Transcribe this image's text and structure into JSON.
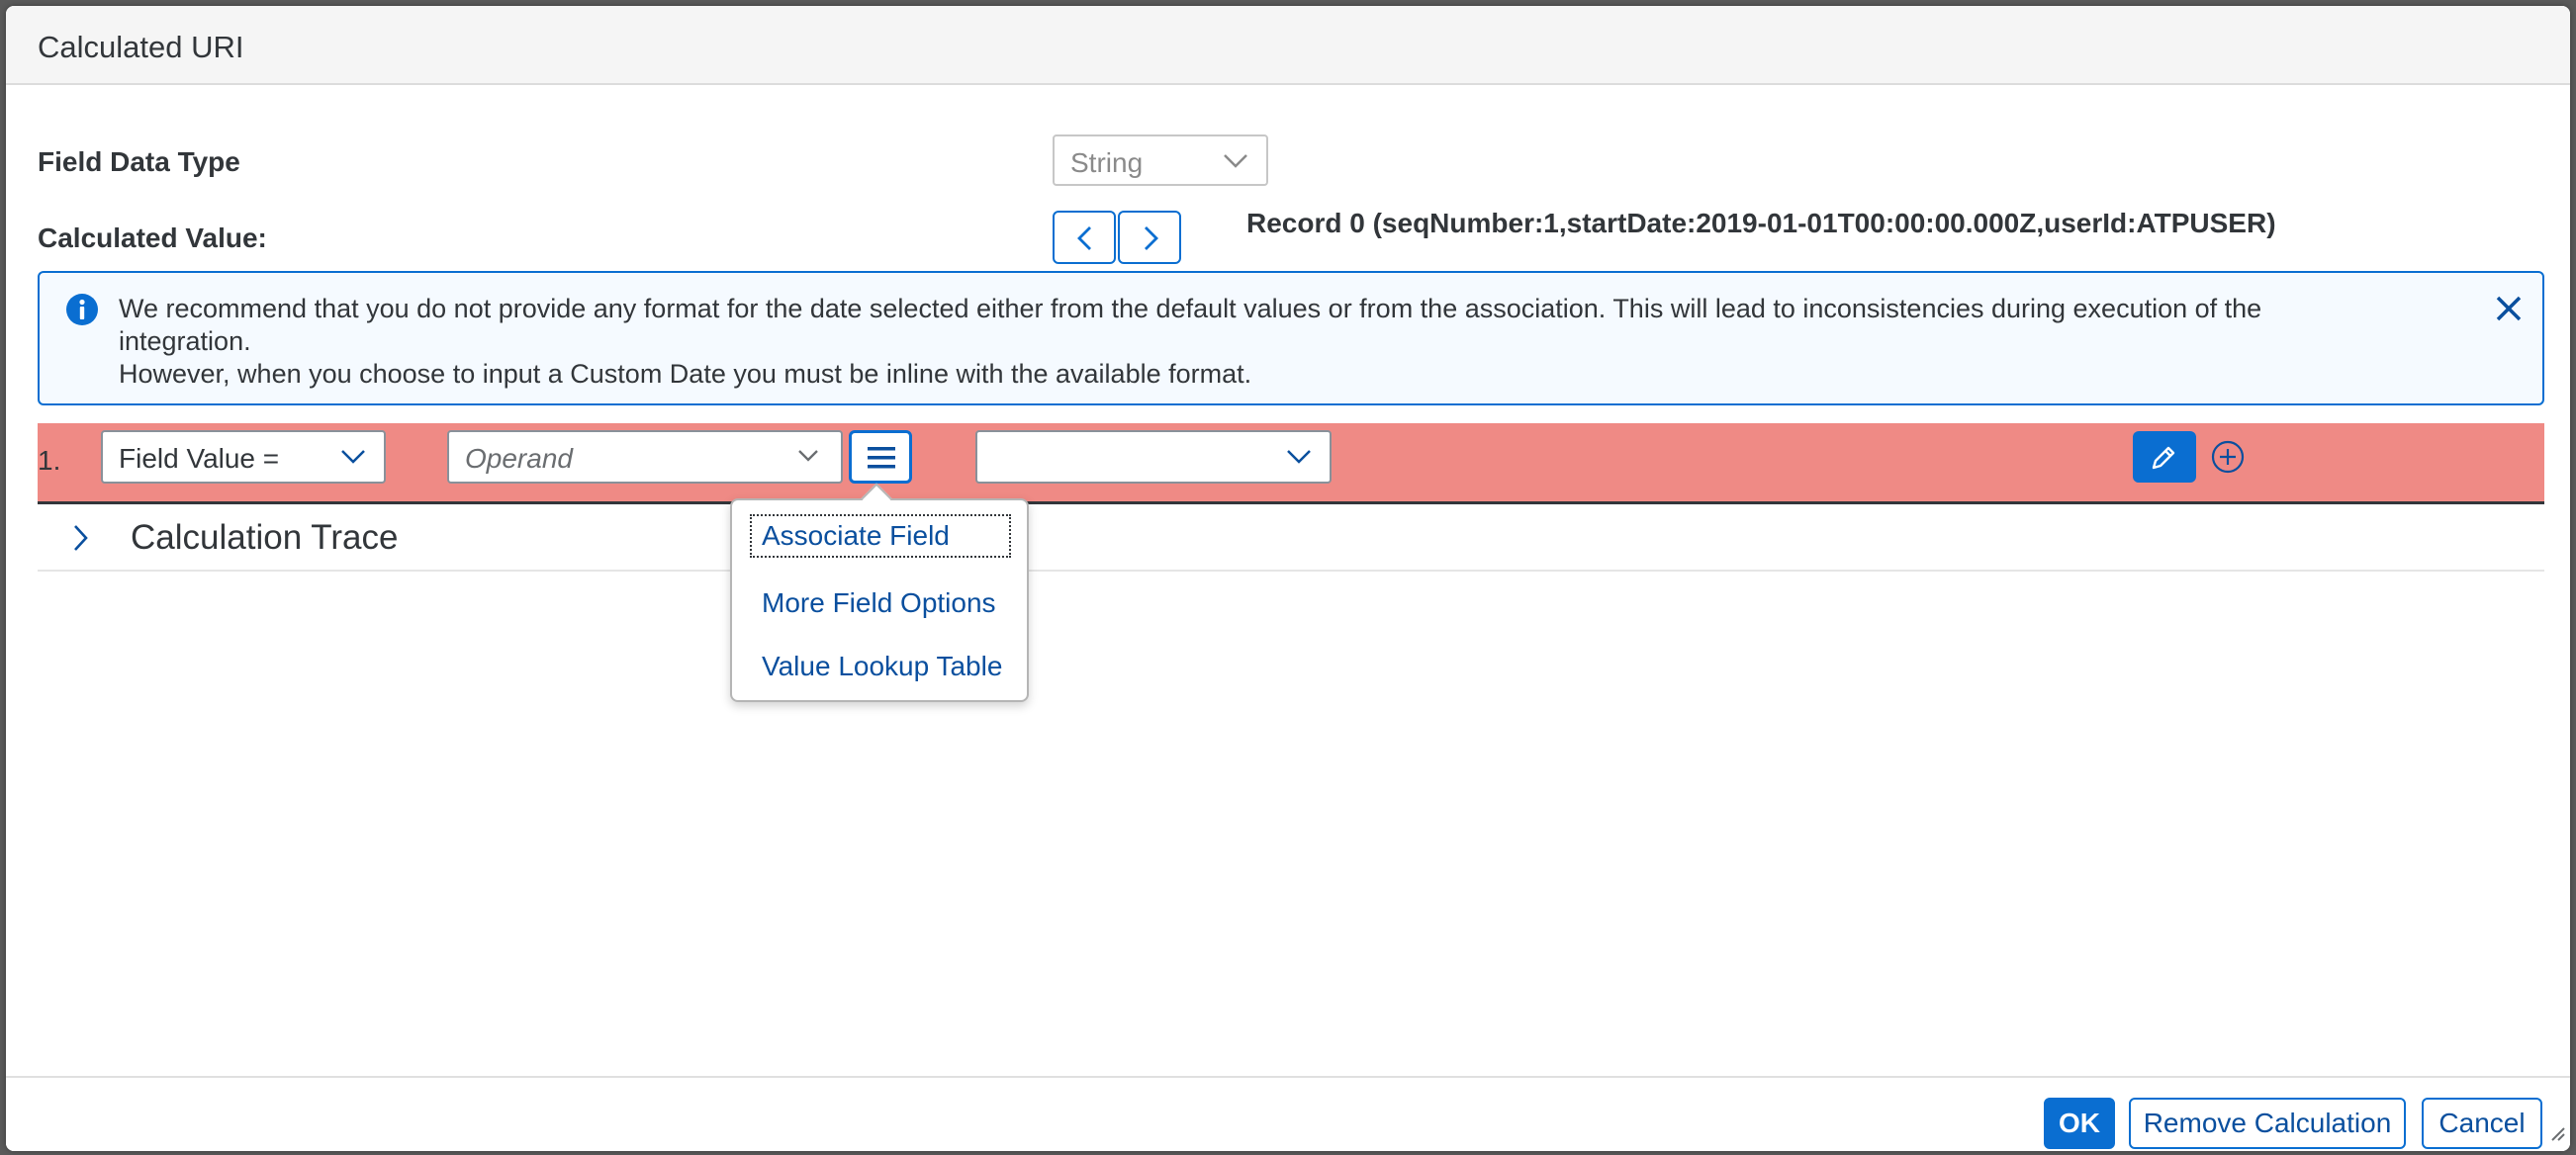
{
  "dialog": {
    "title": "Calculated URI"
  },
  "field_data_type": {
    "label": "Field Data Type",
    "value": "String"
  },
  "calculated_value": {
    "label": "Calculated Value:",
    "record_text": "Record 0 (seqNumber:1,startDate:2019-01-01T00:00:00.000Z,userId:ATPUSER)"
  },
  "info_strip": {
    "line1": "We recommend that you do not provide any format for the date selected either from the default values or from the association. This will lead to inconsistencies during execution of the integration.",
    "line2": "However, when you choose to input a Custom Date you must be inline with the available format."
  },
  "calc_row": {
    "number": "1.",
    "field_select": "Field Value =",
    "operand_placeholder": "Operand",
    "value_select": ""
  },
  "trace": {
    "title": "Calculation Trace"
  },
  "popover": {
    "items": [
      "Associate Field",
      "More Field Options",
      "Value Lookup Table"
    ]
  },
  "footer": {
    "ok_label": "OK",
    "remove_label": "Remove Calculation",
    "cancel_label": "Cancel"
  },
  "colors": {
    "accent": "#0a6ed1",
    "error_row": "#ef8a85",
    "info_bg": "#f5faff"
  }
}
